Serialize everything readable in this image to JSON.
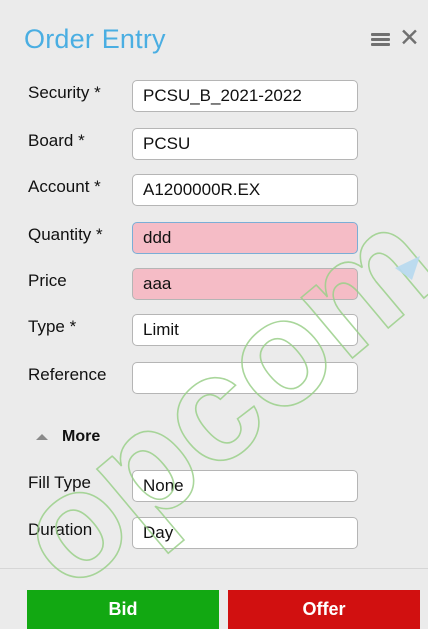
{
  "header": {
    "title": "Order Entry",
    "menu_icon": "menu-icon",
    "close_icon": "close-icon",
    "close_glyph": "✕"
  },
  "form": {
    "security": {
      "label": "Security *",
      "value": "PCSU_B_2021-2022"
    },
    "board": {
      "label": "Board *",
      "value": "PCSU"
    },
    "account": {
      "label": "Account *",
      "value": "A1200000R.EX"
    },
    "quantity": {
      "label": "Quantity *",
      "value": "ddd"
    },
    "price": {
      "label": "Price",
      "value": "aaa"
    },
    "type": {
      "label": "Type *",
      "value": "Limit"
    },
    "reference": {
      "label": "Reference",
      "value": ""
    }
  },
  "more": {
    "label": "More",
    "icon": "triangle-up-icon"
  },
  "extra": {
    "fill_type": {
      "label": "Fill Type",
      "value": "None"
    },
    "duration": {
      "label": "Duration",
      "value": "Day"
    }
  },
  "actions": {
    "bid_label": "Bid",
    "offer_label": "Offer"
  },
  "colors": {
    "title": "#4aaee2",
    "error_bg": "#f5bcc6",
    "bid": "#12a812",
    "offer": "#d11010"
  },
  "watermark": {
    "text": "opcom"
  }
}
